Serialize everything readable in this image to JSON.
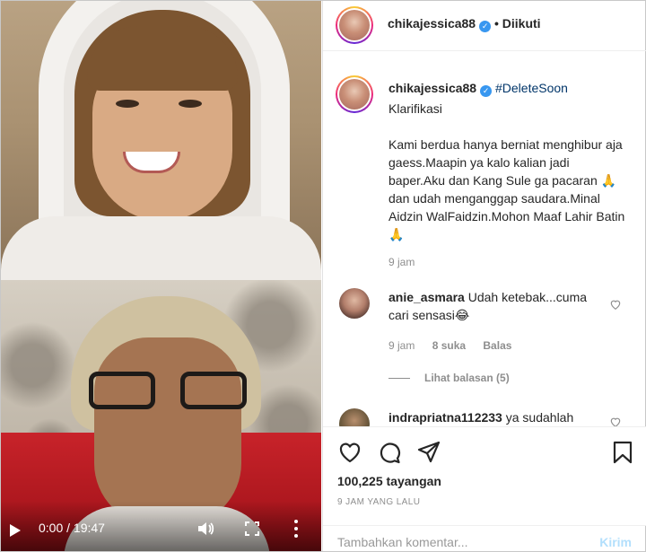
{
  "video": {
    "time_current": "0:00",
    "time_total": "19:47",
    "icons": {
      "play": "play-icon",
      "volume": "volume-icon",
      "fullscreen": "fullscreen-icon",
      "more": "more-vertical-icon"
    }
  },
  "header": {
    "username": "chikajessica88",
    "verified_icon": "verified-badge-icon",
    "follow_status": "• Diikuti"
  },
  "caption": {
    "username": "chikajessica88",
    "hashtag": "#DeleteSoon",
    "title": "Klarifikasi",
    "body": "Kami berdua hanya berniat menghibur aja gaess.Maapin ya kalo kalian jadi baper.Aku dan Kang Sule ga pacaran 🙏 dan udah menganggap saudara.Minal Aidzin WalFaidzin.Mohon Maaf Lahir Batin 🙏",
    "time": "9 jam"
  },
  "comments": [
    {
      "username": "anie_asmara",
      "text": "Udah ketebak...cuma cari sensasi😂",
      "time": "9 jam",
      "likes": "8 suka",
      "reply": "Balas",
      "view_replies": "Lihat balasan (5)"
    },
    {
      "username": "indrapriatna112233",
      "text": "ya sudahlah"
    }
  ],
  "actions": {
    "icons": [
      "heart-icon",
      "comment-icon",
      "share-icon",
      "bookmark-icon"
    ],
    "views": "100,225 tayangan",
    "posted": "9 JAM YANG LALU"
  },
  "add_comment": {
    "placeholder": "Tambahkan komentar...",
    "post_label": "Kirim"
  },
  "colors": {
    "verified": "#3897f0",
    "hashtag": "#003569",
    "muted": "#8e8e8e",
    "post_disabled": "#b2dffc"
  }
}
